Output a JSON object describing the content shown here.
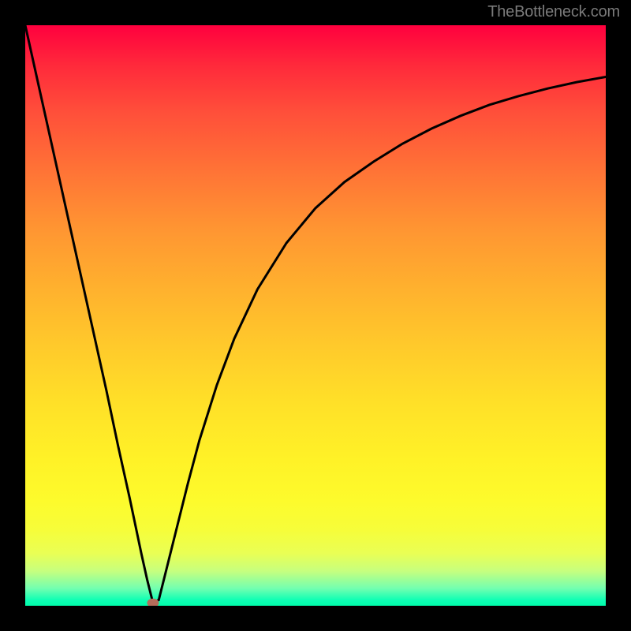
{
  "watermark": {
    "text": "TheBottleneck.com"
  },
  "chart_data": {
    "type": "line",
    "title": "",
    "xlabel": "",
    "ylabel": "",
    "xlim": [
      0,
      100
    ],
    "ylim": [
      0,
      100
    ],
    "series": [
      {
        "name": "bottleneck-curve",
        "x": [
          0,
          2,
          4,
          6,
          8,
          10,
          12,
          14,
          16,
          18,
          20,
          21,
          22,
          23,
          24,
          26,
          28,
          30,
          33,
          36,
          40,
          45,
          50,
          55,
          60,
          65,
          70,
          75,
          80,
          85,
          90,
          95,
          100
        ],
        "y": [
          100,
          91,
          82,
          73,
          64,
          55,
          46,
          37,
          27.5,
          18.5,
          9,
          4.5,
          0.5,
          1,
          5,
          13,
          21,
          28.5,
          38,
          46,
          54.5,
          62.5,
          68.5,
          73,
          76.5,
          79.6,
          82.2,
          84.4,
          86.3,
          87.8,
          89.1,
          90.2,
          91.1
        ]
      }
    ],
    "vertex": {
      "x": 22,
      "y": 0.5
    },
    "background": {
      "top_color": "#ff003e",
      "bottom_color": "#00fdab",
      "description": "vertical gradient red→orange→yellow→green"
    }
  }
}
